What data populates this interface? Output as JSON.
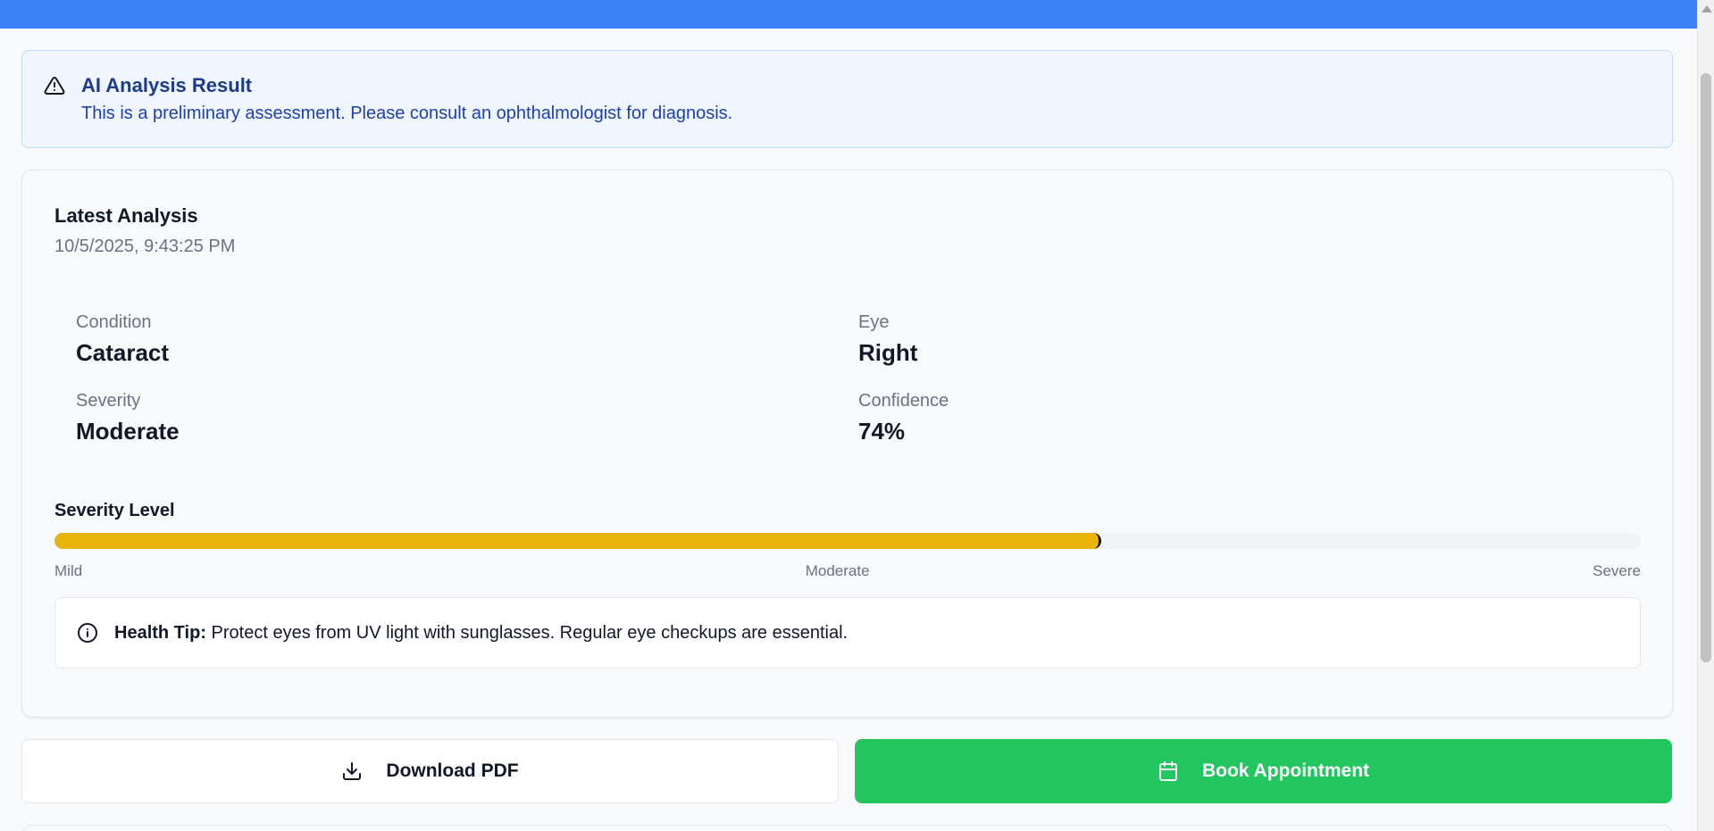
{
  "alert": {
    "title": "AI Analysis Result",
    "description": "This is a preliminary assessment. Please consult an ophthalmologist for diagnosis.",
    "icon": "warning-triangle-icon"
  },
  "analysis": {
    "title": "Latest Analysis",
    "timestamp": "10/5/2025, 9:43:25 PM",
    "fields": {
      "condition": {
        "label": "Condition",
        "value": "Cataract"
      },
      "eye": {
        "label": "Eye",
        "value": "Right"
      },
      "severity": {
        "label": "Severity",
        "value": "Moderate"
      },
      "confidence": {
        "label": "Confidence",
        "value": "74%"
      }
    },
    "severity_level": {
      "title": "Severity Level",
      "fill_fraction": 0.66,
      "scale": [
        "Mild",
        "Moderate",
        "Severe"
      ],
      "color": "#eab308"
    },
    "health_tip": {
      "label": "Health Tip:",
      "text": " Protect eyes from UV light with sunglasses. Regular eye checkups are essential.",
      "icon": "info-circle-icon"
    }
  },
  "actions": {
    "download_label": "Download PDF",
    "download_icon": "download-icon",
    "book_label": "Book Appointment",
    "book_icon": "calendar-icon"
  },
  "colors": {
    "topbar": "#3b82f6",
    "accent_green": "#22c55e",
    "alert_bg": "#eff6ff"
  }
}
